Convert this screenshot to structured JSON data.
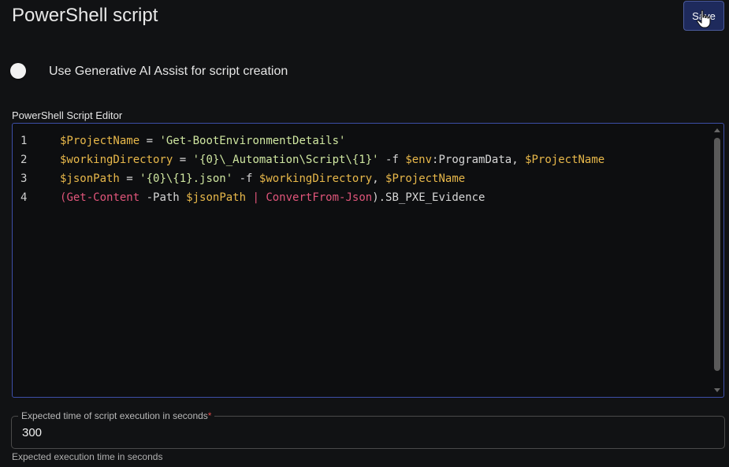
{
  "header": {
    "title": "PowerShell script",
    "save_label": "Save"
  },
  "toggle": {
    "label": "Use Generative AI Assist for script creation",
    "enabled": false
  },
  "editor": {
    "label": "PowerShell Script Editor",
    "lines": [
      {
        "number": "1",
        "tokens": [
          {
            "t": "var",
            "v": "$ProjectName"
          },
          {
            "t": "op",
            "v": " = "
          },
          {
            "t": "str",
            "v": "'Get-BootEnvironmentDetails'"
          }
        ]
      },
      {
        "number": "2",
        "tokens": [
          {
            "t": "var",
            "v": "$workingDirectory"
          },
          {
            "t": "op",
            "v": " = "
          },
          {
            "t": "str",
            "v": "'{0}\\_Automation\\Script\\{1}'"
          },
          {
            "t": "op",
            "v": " -f "
          },
          {
            "t": "var",
            "v": "$env"
          },
          {
            "t": "plain",
            "v": ":ProgramData, "
          },
          {
            "t": "var",
            "v": "$ProjectName"
          }
        ]
      },
      {
        "number": "3",
        "tokens": [
          {
            "t": "var",
            "v": "$jsonPath"
          },
          {
            "t": "op",
            "v": " = "
          },
          {
            "t": "str",
            "v": "'{0}\\{1}.json'"
          },
          {
            "t": "op",
            "v": " -f "
          },
          {
            "t": "var",
            "v": "$workingDirectory"
          },
          {
            "t": "plain",
            "v": ", "
          },
          {
            "t": "var",
            "v": "$ProjectName"
          }
        ]
      },
      {
        "number": "4",
        "tokens": [
          {
            "t": "cmd",
            "v": "("
          },
          {
            "t": "cmd",
            "v": "Get-Content"
          },
          {
            "t": "plain",
            "v": " -Path "
          },
          {
            "t": "var",
            "v": "$jsonPath"
          },
          {
            "t": "cmd",
            "v": " | "
          },
          {
            "t": "cmd",
            "v": "ConvertFrom-Json"
          },
          {
            "t": "plain",
            "v": ").SB_PXE_Evidence"
          }
        ]
      }
    ]
  },
  "execution_time": {
    "label": "Expected time of script execution in seconds",
    "required_mark": "*",
    "value": "300",
    "helper": "Expected execution time in seconds"
  },
  "colors": {
    "accent": "#3d4fa8",
    "variable": "#e8b84a",
    "string": "#cfe6a0",
    "command": "#e0557a",
    "required": "#e04848"
  },
  "icons": {
    "cursor": "hand-pointer-icon"
  }
}
